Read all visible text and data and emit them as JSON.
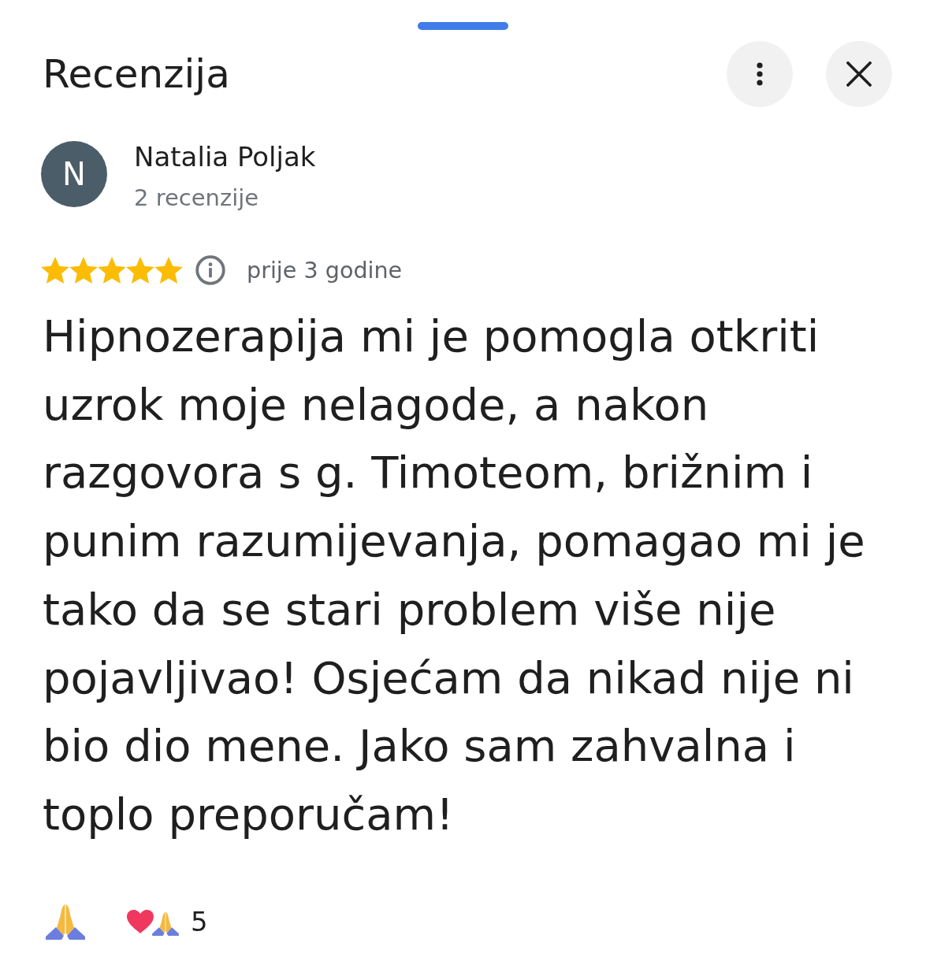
{
  "sheet": {
    "title": "Recenzija"
  },
  "review": {
    "author": {
      "initial": "N",
      "name": "Natalia Poljak",
      "review_count": "2 recenzije"
    },
    "stars": 5,
    "time": "prije 3 godine",
    "text": "Hipnozerapija mi je pomogla otkriti uzrok moje nelagode, a nakon razgovora s g. Timoteom, brižnim i punim razumijevanja, pomagao mi je tako da se stari problem više nije pojavljivao! Osjećam da nikad nije ni bio dio mene. Jako sam zahvalna i toplo preporučam!"
  },
  "reactions": {
    "count": "5"
  }
}
